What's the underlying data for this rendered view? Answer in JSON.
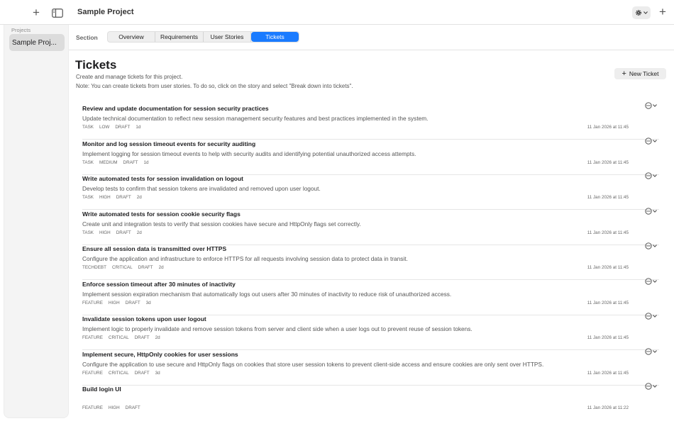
{
  "window": {
    "title": "Sample Project"
  },
  "sidebar": {
    "header": "Projects",
    "items": [
      {
        "label": "Sample Proj..."
      }
    ]
  },
  "section": {
    "label": "Section",
    "tabs": [
      {
        "label": "Overview",
        "active": false
      },
      {
        "label": "Requirements",
        "active": false
      },
      {
        "label": "User Stories",
        "active": false
      },
      {
        "label": "Tickets",
        "active": true
      }
    ]
  },
  "page": {
    "title": "Tickets",
    "subtitle": "Create and manage tickets for this project.",
    "note": "Note: You can create tickets from user stories. To do so, click on the story and select \"Break down into tickets\".",
    "new_ticket_label": "New Ticket"
  },
  "tickets": [
    {
      "title": "Review and update documentation for session security practices",
      "description": "Update technical documentation to reflect new session management security features and best practices implemented in the system.",
      "type": "TASK",
      "priority": "LOW",
      "status": "DRAFT",
      "age": "1d",
      "date": "11 Jan 2026 at 11:45"
    },
    {
      "title": "Monitor and log session timeout events for security auditing",
      "description": "Implement logging for session timeout events to help with security audits and identifying potential unauthorized access attempts.",
      "type": "TASK",
      "priority": "MEDIUM",
      "status": "DRAFT",
      "age": "1d",
      "date": "11 Jan 2026 at 11:45"
    },
    {
      "title": "Write automated tests for session invalidation on logout",
      "description": "Develop tests to confirm that session tokens are invalidated and removed upon user logout.",
      "type": "TASK",
      "priority": "HIGH",
      "status": "DRAFT",
      "age": "2d",
      "date": "11 Jan 2026 at 11:45"
    },
    {
      "title": "Write automated tests for session cookie security flags",
      "description": "Create unit and integration tests to verify that session cookies have secure and HttpOnly flags set correctly.",
      "type": "TASK",
      "priority": "HIGH",
      "status": "DRAFT",
      "age": "2d",
      "date": "11 Jan 2026 at 11:45"
    },
    {
      "title": "Ensure all session data is transmitted over HTTPS",
      "description": "Configure the application and infrastructure to enforce HTTPS for all requests involving session data to protect data in transit.",
      "type": "TECHDEBT",
      "priority": "CRITICAL",
      "status": "DRAFT",
      "age": "2d",
      "date": "11 Jan 2026 at 11:45"
    },
    {
      "title": "Enforce session timeout after 30 minutes of inactivity",
      "description": "Implement session expiration mechanism that automatically logs out users after 30 minutes of inactivity to reduce risk of unauthorized access.",
      "type": "FEATURE",
      "priority": "HIGH",
      "status": "DRAFT",
      "age": "3d",
      "date": "11 Jan 2026 at 11:45"
    },
    {
      "title": "Invalidate session tokens upon user logout",
      "description": "Implement logic to properly invalidate and remove session tokens from server and client side when a user logs out to prevent reuse of session tokens.",
      "type": "FEATURE",
      "priority": "CRITICAL",
      "status": "DRAFT",
      "age": "2d",
      "date": "11 Jan 2026 at 11:45"
    },
    {
      "title": "Implement secure, HttpOnly cookies for user sessions",
      "description": "Configure the application to use secure and HttpOnly flags on cookies that store user session tokens to prevent client-side access and ensure cookies are only sent over HTTPS.",
      "type": "FEATURE",
      "priority": "CRITICAL",
      "status": "DRAFT",
      "age": "3d",
      "date": "11 Jan 2026 at 11:45"
    },
    {
      "title": "Build login UI",
      "description": "",
      "type": "FEATURE",
      "priority": "HIGH",
      "status": "DRAFT",
      "age": "",
      "date": "11 Jan 2026 at 11:22"
    }
  ],
  "icons": {
    "add": "plus-icon",
    "sidebar_toggle": "sidebar-icon",
    "settings": "gear-icon",
    "ticket_menu": "ellipsis-circle-icon",
    "chevron": "chevron-down-icon"
  },
  "colors": {
    "accent": "#1a7bff"
  }
}
